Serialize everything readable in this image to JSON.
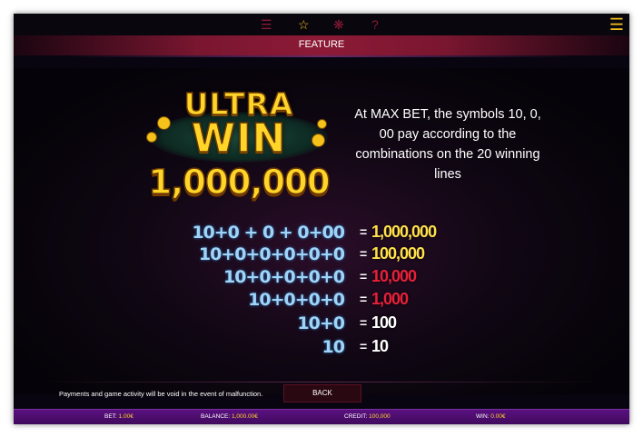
{
  "topbar": {
    "icons": [
      "paytable-icon",
      "star-icon",
      "settings-icon",
      "help-icon"
    ],
    "menu_icon": "menu-list-icon"
  },
  "feature": {
    "title": "FEATURE"
  },
  "logo": {
    "line1": "ULTRA",
    "line2": "WIN",
    "amount": "1,000,000"
  },
  "description": "At MAX BET, the symbols 10, 0, 00 pay according to the combinations on the 20 winning lines",
  "paytable": [
    {
      "combo": "10+0 + 0 + 0+00",
      "eq": "=",
      "pay": "1,000,000",
      "color": "#ffe14a"
    },
    {
      "combo": "10+0+0+0+0+0",
      "eq": "=",
      "pay": "100,000",
      "color": "#ffe14a"
    },
    {
      "combo": "10+0+0+0+0",
      "eq": "=",
      "pay": "10,000",
      "color": "#e8203a"
    },
    {
      "combo": "10+0+0+0",
      "eq": "=",
      "pay": "1,000",
      "color": "#e8203a"
    },
    {
      "combo": "10+0",
      "eq": "=",
      "pay": "100",
      "color": "#ffffff"
    },
    {
      "combo": "10",
      "eq": "=",
      "pay": "10",
      "color": "#ffffff"
    }
  ],
  "footer": {
    "disclaimer": "Payments and game activity will be void in the event of malfunction.",
    "back_label": "BACK"
  },
  "status": {
    "bet_label": "BET:",
    "bet_value": "1.00€",
    "balance_label": "BALANCE:",
    "balance_value": "1,000.00€",
    "credit_label": "CREDIT:",
    "credit_value": "100,000",
    "win_label": "WIN:",
    "win_value": "0.00€"
  },
  "colors": {
    "accent": "#8c1a36",
    "gold": "#ffd52a",
    "status_bar": "#4a0d6a",
    "combo_blue": "#9fd4f7"
  }
}
